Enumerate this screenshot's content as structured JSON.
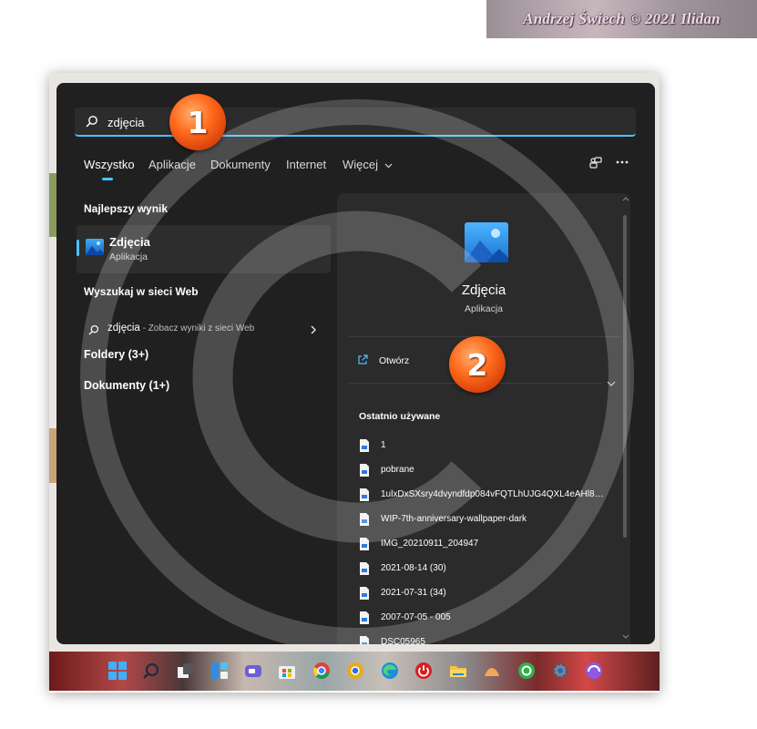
{
  "watermark": {
    "text": "Andrzej Świech © 2021 Ilidan"
  },
  "search": {
    "value": "zdjęcia"
  },
  "tabs": [
    {
      "label": "Wszystko"
    },
    {
      "label": "Aplikacje"
    },
    {
      "label": "Dokumenty"
    },
    {
      "label": "Internet"
    },
    {
      "label": "Więcej"
    }
  ],
  "icons": {
    "search": "search-icon",
    "share": "share-icon",
    "more": "more-icon",
    "photos": "photos-app-icon",
    "open": "open-external-icon",
    "expand": "chevron-down-icon",
    "file": "file-icon"
  },
  "best_match": {
    "title": "Najlepszy wynik",
    "name": "Zdjęcia",
    "type": "Aplikacja"
  },
  "web_search": {
    "title": "Wyszukaj w sieci Web",
    "query": "zdjęcia",
    "suffix": " - Zobacz wyniki z sieci Web"
  },
  "folders": {
    "label": "Foldery (3+)"
  },
  "documents": {
    "label": "Dokumenty (1+)"
  },
  "details": {
    "name": "Zdjęcia",
    "type": "Aplikacja",
    "open_label": "Otwórz",
    "recent_title": "Ostatnio używane",
    "recent": [
      "1",
      "pobrane",
      "1ulxDxSXsry4dvyndfdp084vFQTLhUJG4QXL4eAHl8T...",
      "WIP-7th-anniversary-wallpaper-dark",
      "IMG_20210911_204947",
      "2021-08-14 (30)",
      "2021-07-31 (34)",
      "2007-07-05 - 005",
      "DSC05965"
    ]
  },
  "markers": {
    "one": "1",
    "two": "2"
  },
  "colors": {
    "accent": "#4cc2ff",
    "panel": "#202020",
    "marker": "#ff6a1c"
  }
}
